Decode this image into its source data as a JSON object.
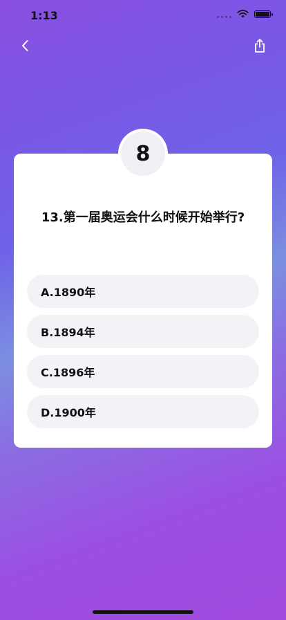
{
  "status": {
    "time": "1:13"
  },
  "quiz": {
    "countdown": "8",
    "question": "13.第一届奥运会什么时候开始举行?",
    "options": [
      {
        "label": "A.1890年"
      },
      {
        "label": "B.1894年"
      },
      {
        "label": "C.1896年"
      },
      {
        "label": "D.1900年"
      }
    ]
  },
  "icons": {
    "back": "chevron-left-icon",
    "share": "share-icon"
  },
  "colors": {
    "card": "#ffffff",
    "option_bg": "#f2f2f7",
    "badge_bg": "#f0f0f4",
    "text": "#111111"
  }
}
